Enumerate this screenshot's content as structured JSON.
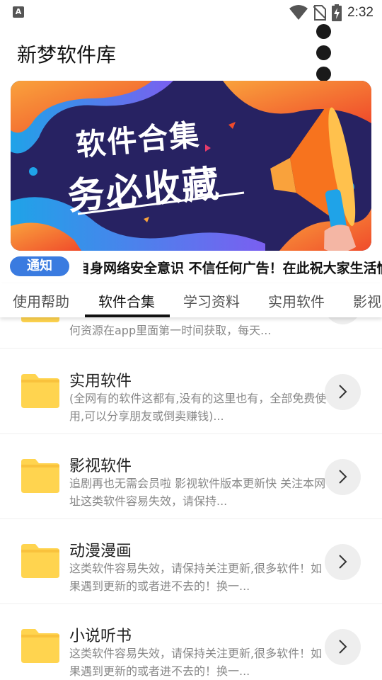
{
  "status_bar": {
    "time": "2:32",
    "app_badge": "A"
  },
  "header": {
    "title": "新梦软件库"
  },
  "banner": {
    "line1": "软件合集",
    "line2": "务必收藏"
  },
  "notice": {
    "badge": "通知",
    "text": "提高自身网络安全意识 不信任何广告！在此祝大家生活愉快"
  },
  "tabs": [
    {
      "label": "使用帮助"
    },
    {
      "label": "软件合集"
    },
    {
      "label": "学习资料"
    },
    {
      "label": "实用软件"
    },
    {
      "label": "影视"
    }
  ],
  "active_tab": "软件合集",
  "list": {
    "items": [
      {
        "title": "",
        "desc": "何资源在app里面第一时间获取，每天..."
      },
      {
        "title": "实用软件",
        "desc": "(全网有的软件这都有,没有的这里也有，全部免费使用,可以分享朋友或倒卖赚钱)..."
      },
      {
        "title": "影视软件",
        "desc": "追剧再也无需会员啦 影视软件版本更新快 关注本网址这类软件容易失效，请保持..."
      },
      {
        "title": "动漫漫画",
        "desc": "这类软件容易失效，请保持关注更新,很多软件！如果遇到更新的或者进不去的！换一..."
      },
      {
        "title": "小说听书",
        "desc": "这类软件容易失效，请保持关注更新,很多软件！如果遇到更新的或者进不去的！换一..."
      }
    ]
  },
  "colors": {
    "accent_blue": "#3a7be0",
    "folder_yellow": "#ffd44f",
    "banner_bg": "#272262",
    "banner_orange": "#f7731e"
  },
  "icons": [
    "wifi-icon",
    "no-sim-icon",
    "battery-charging-icon",
    "folder-icon",
    "chevron-right-icon",
    "overflow-menu-icon"
  ]
}
